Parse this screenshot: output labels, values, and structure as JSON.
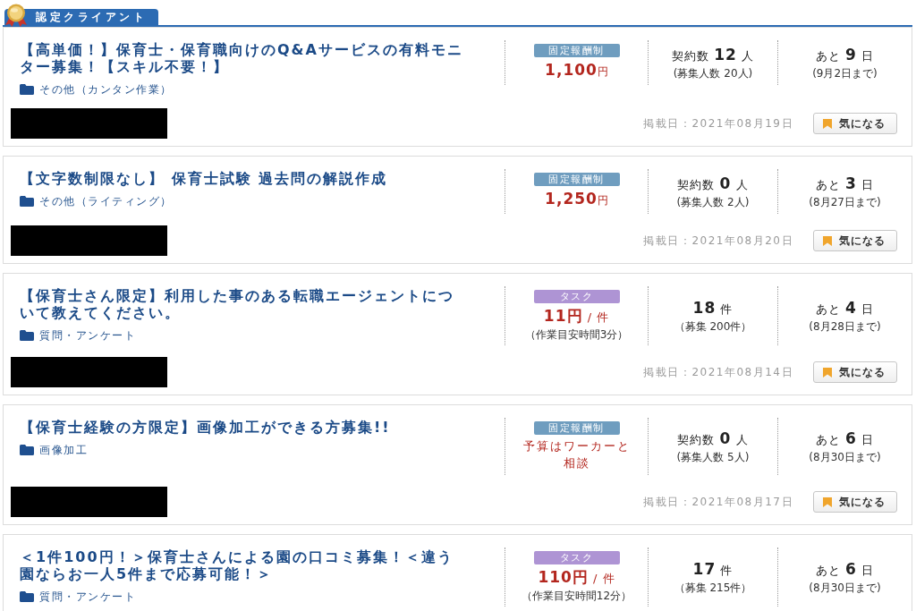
{
  "section_tab": {
    "label": "認定クライアント"
  },
  "jobs": [
    {
      "title": "【高単価！】保育士・保育職向けのQ&Aサービスの有料モニター募集！【スキル不要！】",
      "category": "その他（カンタン作業）",
      "pay": {
        "kind": "fixed",
        "badge": "固定報酬制",
        "amount": "1,100",
        "unit": "円"
      },
      "count": {
        "label": "契約数",
        "number": "12",
        "unit": "人",
        "sub": "(募集人数 20人)"
      },
      "deadline": {
        "prefix": "あと",
        "number": "9",
        "unit": "日",
        "sub": "(9月2日まで)"
      },
      "footer": {
        "client_redacted": true,
        "posted": "掲載日：2021年08月19日",
        "bookmark_button": "気になる"
      }
    },
    {
      "title": "【文字数制限なし】 保育士試験 過去問の解説作成",
      "category": "その他（ライティング）",
      "pay": {
        "kind": "fixed",
        "badge": "固定報酬制",
        "amount": "1,250",
        "unit": "円"
      },
      "count": {
        "label": "契約数",
        "number": "0",
        "unit": "人",
        "sub": "(募集人数 2人)"
      },
      "deadline": {
        "prefix": "あと",
        "number": "3",
        "unit": "日",
        "sub": "(8月27日まで)"
      },
      "footer": {
        "client_redacted": true,
        "posted": "掲載日：2021年08月20日",
        "bookmark_button": "気になる"
      }
    },
    {
      "title": "【保育士さん限定】利用した事のある転職エージェントについて教えてください。",
      "category": "質問・アンケート",
      "pay": {
        "kind": "task",
        "badge": "タスク",
        "amount": "11円",
        "per": "/ 件",
        "note": "（作業目安時間3分）"
      },
      "count": {
        "number": "18",
        "unit": "件",
        "sub": "（募集 200件）"
      },
      "deadline": {
        "prefix": "あと",
        "number": "4",
        "unit": "日",
        "sub": "(8月28日まで)"
      },
      "footer": {
        "client_redacted": true,
        "posted": "掲載日：2021年08月14日",
        "bookmark_button": "気になる"
      }
    },
    {
      "title": "【保育士経験の方限定】画像加工ができる方募集!!",
      "category": "画像加工",
      "pay": {
        "kind": "fixed",
        "badge": "固定報酬制",
        "budget_note": "予算はワーカーと相談"
      },
      "count": {
        "label": "契約数",
        "number": "0",
        "unit": "人",
        "sub": "(募集人数 5人)"
      },
      "deadline": {
        "prefix": "あと",
        "number": "6",
        "unit": "日",
        "sub": "(8月30日まで)"
      },
      "footer": {
        "client_redacted": true,
        "posted": "掲載日：2021年08月17日",
        "bookmark_button": "気になる"
      }
    },
    {
      "title": "＜1件100円！＞保育士さんによる園の口コミ募集！＜違う園ならお一人5件まで応募可能！＞",
      "category": "質問・アンケート",
      "pay": {
        "kind": "task",
        "badge": "タスク",
        "amount": "110円",
        "per": "/ 件",
        "note": "（作業目安時間12分）"
      },
      "count": {
        "number": "17",
        "unit": "件",
        "sub": "（募集 215件）"
      },
      "deadline": {
        "prefix": "あと",
        "number": "6",
        "unit": "日",
        "sub": "(8月30日まで)"
      }
    }
  ]
}
